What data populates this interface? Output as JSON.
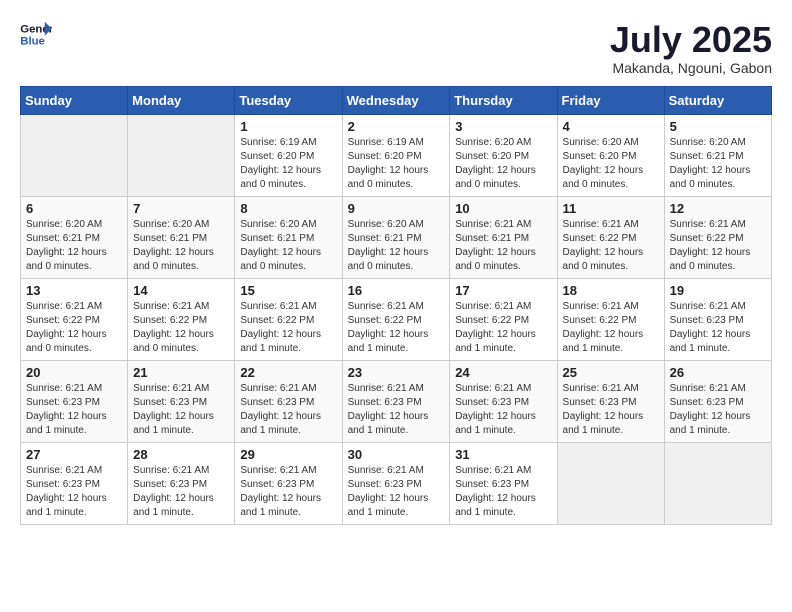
{
  "logo": {
    "line1": "General",
    "line2": "Blue"
  },
  "title": "July 2025",
  "subtitle": "Makanda, Ngouni, Gabon",
  "days_header": [
    "Sunday",
    "Monday",
    "Tuesday",
    "Wednesday",
    "Thursday",
    "Friday",
    "Saturday"
  ],
  "weeks": [
    [
      {
        "day": "",
        "info": ""
      },
      {
        "day": "",
        "info": ""
      },
      {
        "day": "1",
        "info": "Sunrise: 6:19 AM\nSunset: 6:20 PM\nDaylight: 12 hours and 0 minutes."
      },
      {
        "day": "2",
        "info": "Sunrise: 6:19 AM\nSunset: 6:20 PM\nDaylight: 12 hours and 0 minutes."
      },
      {
        "day": "3",
        "info": "Sunrise: 6:20 AM\nSunset: 6:20 PM\nDaylight: 12 hours and 0 minutes."
      },
      {
        "day": "4",
        "info": "Sunrise: 6:20 AM\nSunset: 6:20 PM\nDaylight: 12 hours and 0 minutes."
      },
      {
        "day": "5",
        "info": "Sunrise: 6:20 AM\nSunset: 6:21 PM\nDaylight: 12 hours and 0 minutes."
      }
    ],
    [
      {
        "day": "6",
        "info": "Sunrise: 6:20 AM\nSunset: 6:21 PM\nDaylight: 12 hours and 0 minutes."
      },
      {
        "day": "7",
        "info": "Sunrise: 6:20 AM\nSunset: 6:21 PM\nDaylight: 12 hours and 0 minutes."
      },
      {
        "day": "8",
        "info": "Sunrise: 6:20 AM\nSunset: 6:21 PM\nDaylight: 12 hours and 0 minutes."
      },
      {
        "day": "9",
        "info": "Sunrise: 6:20 AM\nSunset: 6:21 PM\nDaylight: 12 hours and 0 minutes."
      },
      {
        "day": "10",
        "info": "Sunrise: 6:21 AM\nSunset: 6:21 PM\nDaylight: 12 hours and 0 minutes."
      },
      {
        "day": "11",
        "info": "Sunrise: 6:21 AM\nSunset: 6:22 PM\nDaylight: 12 hours and 0 minutes."
      },
      {
        "day": "12",
        "info": "Sunrise: 6:21 AM\nSunset: 6:22 PM\nDaylight: 12 hours and 0 minutes."
      }
    ],
    [
      {
        "day": "13",
        "info": "Sunrise: 6:21 AM\nSunset: 6:22 PM\nDaylight: 12 hours and 0 minutes."
      },
      {
        "day": "14",
        "info": "Sunrise: 6:21 AM\nSunset: 6:22 PM\nDaylight: 12 hours and 0 minutes."
      },
      {
        "day": "15",
        "info": "Sunrise: 6:21 AM\nSunset: 6:22 PM\nDaylight: 12 hours and 1 minute."
      },
      {
        "day": "16",
        "info": "Sunrise: 6:21 AM\nSunset: 6:22 PM\nDaylight: 12 hours and 1 minute."
      },
      {
        "day": "17",
        "info": "Sunrise: 6:21 AM\nSunset: 6:22 PM\nDaylight: 12 hours and 1 minute."
      },
      {
        "day": "18",
        "info": "Sunrise: 6:21 AM\nSunset: 6:22 PM\nDaylight: 12 hours and 1 minute."
      },
      {
        "day": "19",
        "info": "Sunrise: 6:21 AM\nSunset: 6:23 PM\nDaylight: 12 hours and 1 minute."
      }
    ],
    [
      {
        "day": "20",
        "info": "Sunrise: 6:21 AM\nSunset: 6:23 PM\nDaylight: 12 hours and 1 minute."
      },
      {
        "day": "21",
        "info": "Sunrise: 6:21 AM\nSunset: 6:23 PM\nDaylight: 12 hours and 1 minute."
      },
      {
        "day": "22",
        "info": "Sunrise: 6:21 AM\nSunset: 6:23 PM\nDaylight: 12 hours and 1 minute."
      },
      {
        "day": "23",
        "info": "Sunrise: 6:21 AM\nSunset: 6:23 PM\nDaylight: 12 hours and 1 minute."
      },
      {
        "day": "24",
        "info": "Sunrise: 6:21 AM\nSunset: 6:23 PM\nDaylight: 12 hours and 1 minute."
      },
      {
        "day": "25",
        "info": "Sunrise: 6:21 AM\nSunset: 6:23 PM\nDaylight: 12 hours and 1 minute."
      },
      {
        "day": "26",
        "info": "Sunrise: 6:21 AM\nSunset: 6:23 PM\nDaylight: 12 hours and 1 minute."
      }
    ],
    [
      {
        "day": "27",
        "info": "Sunrise: 6:21 AM\nSunset: 6:23 PM\nDaylight: 12 hours and 1 minute."
      },
      {
        "day": "28",
        "info": "Sunrise: 6:21 AM\nSunset: 6:23 PM\nDaylight: 12 hours and 1 minute."
      },
      {
        "day": "29",
        "info": "Sunrise: 6:21 AM\nSunset: 6:23 PM\nDaylight: 12 hours and 1 minute."
      },
      {
        "day": "30",
        "info": "Sunrise: 6:21 AM\nSunset: 6:23 PM\nDaylight: 12 hours and 1 minute."
      },
      {
        "day": "31",
        "info": "Sunrise: 6:21 AM\nSunset: 6:23 PM\nDaylight: 12 hours and 1 minute."
      },
      {
        "day": "",
        "info": ""
      },
      {
        "day": "",
        "info": ""
      }
    ]
  ]
}
